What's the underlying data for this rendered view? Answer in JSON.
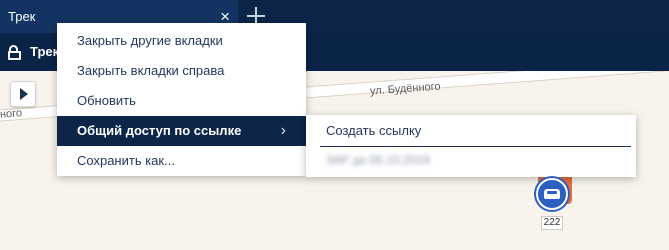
{
  "tab": {
    "title": "Трек",
    "close_glyph": "×",
    "add_icon": "plus-icon"
  },
  "subbar": {
    "title": "Трек",
    "icon": "lock-open-icon"
  },
  "map": {
    "street_label_1": "ул. Будённого",
    "street_label_2": "ного",
    "vehicle_label": "222"
  },
  "context_menu": {
    "items": [
      {
        "label": "Закрыть другие вкладки"
      },
      {
        "label": "Закрыть вкладки справа"
      },
      {
        "label": "Обновить"
      },
      {
        "label": "Общий доступ по ссылке",
        "has_submenu": true,
        "chevron": "›"
      },
      {
        "label": "Сохранить как..."
      }
    ]
  },
  "submenu": {
    "create_link_label": "Создать ссылку",
    "blurred_entry": "ЗАР до 05.10.2019"
  },
  "colors": {
    "header_bg": "#0c2549",
    "active_tab_bg": "#133462",
    "menu_active_bg": "#0c2549",
    "menu_text": "#233a5e",
    "marker_blue": "#2d5fc2",
    "marker_orange": "#e56d3c"
  }
}
